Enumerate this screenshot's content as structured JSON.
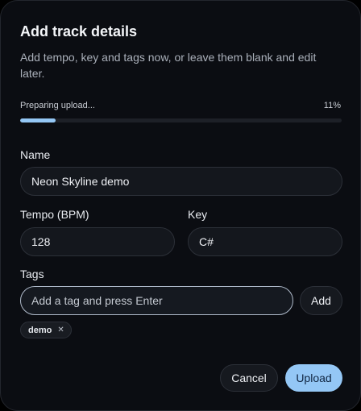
{
  "dialog": {
    "title": "Add track details",
    "subtitle": "Add tempo, key and tags now, or leave them blank and edit later."
  },
  "progress": {
    "label": "Preparing upload...",
    "percent_text": "11%",
    "value": 0.11
  },
  "fields": {
    "name": {
      "label": "Name",
      "value": "Neon Skyline demo"
    },
    "tempo": {
      "label": "Tempo (BPM)",
      "value": "128"
    },
    "key": {
      "label": "Key",
      "value": "C#"
    },
    "tags": {
      "label": "Tags",
      "placeholder": "Add a tag and press Enter",
      "add_label": "Add"
    }
  },
  "tag_chips": [
    {
      "label": "demo",
      "remove_icon": "close-icon",
      "remove_glyph": "✕"
    }
  ],
  "footer": {
    "cancel_label": "Cancel",
    "upload_label": "Upload"
  },
  "colors": {
    "accent": "#94c7f5",
    "background": "#0b0d12",
    "input_bg": "#14171d"
  }
}
